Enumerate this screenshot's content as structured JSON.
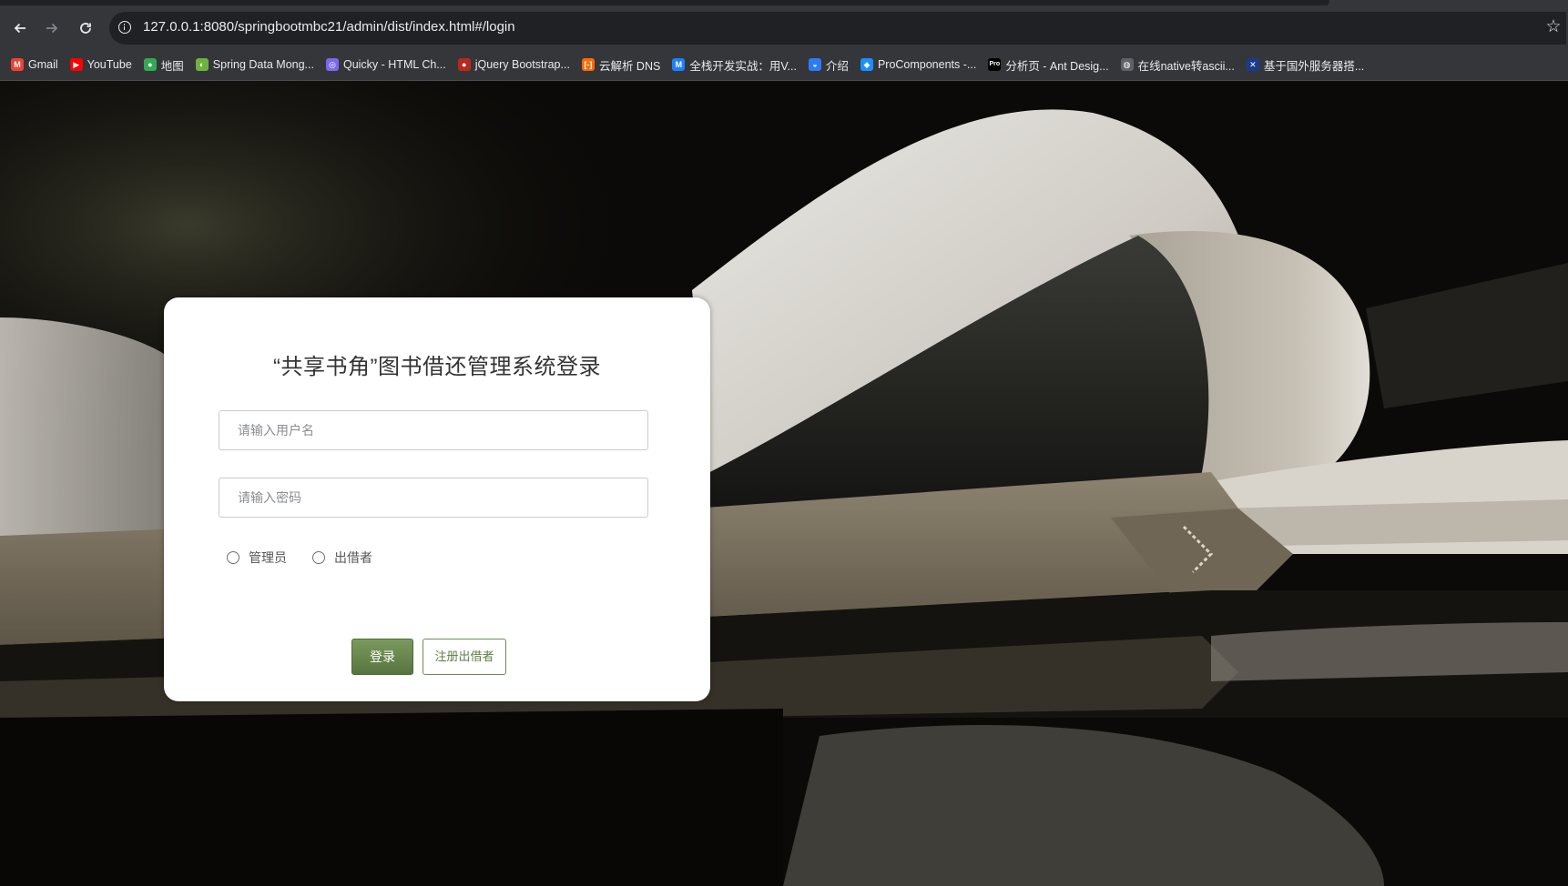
{
  "browser": {
    "url": "127.0.0.1:8080/springbootmbc21/admin/dist/index.html#/login",
    "bookmarks": [
      {
        "label": "Gmail",
        "icon": "gmail-icon",
        "color": "#ea4335",
        "glyph": "M"
      },
      {
        "label": "YouTube",
        "icon": "youtube-icon",
        "color": "#ff0000",
        "glyph": "▶"
      },
      {
        "label": "地图",
        "icon": "maps-icon",
        "color": "#34a853",
        "glyph": "●"
      },
      {
        "label": "Spring Data Mong...",
        "icon": "spring-leaf-icon",
        "color": "#6db33f",
        "glyph": "◐"
      },
      {
        "label": "Quicky - HTML Ch...",
        "icon": "quicky-icon",
        "color": "#7b68ee",
        "glyph": "◎"
      },
      {
        "label": "jQuery Bootstrap...",
        "icon": "jquery-icon",
        "color": "#b7291f",
        "glyph": "●"
      },
      {
        "label": "云解析 DNS",
        "icon": "aliyun-icon",
        "color": "#ff6a00",
        "glyph": "[-]"
      },
      {
        "label": "全栈开发实战：用V...",
        "icon": "m-icon",
        "color": "#1e80ff",
        "glyph": "M"
      },
      {
        "label": "介绍",
        "icon": "intro-icon",
        "color": "#2f7bf5",
        "glyph": "◒"
      },
      {
        "label": "ProComponents -...",
        "icon": "procomponents-icon",
        "color": "#1890ff",
        "glyph": "◆"
      },
      {
        "label": "分析页 - Ant Desig...",
        "icon": "pro-icon",
        "color": "#000000",
        "glyph": "Pro"
      },
      {
        "label": "在线native转ascii...",
        "icon": "globe-icon",
        "color": "#5f6368",
        "glyph": "◍"
      },
      {
        "label": "基于国外服务器搭...",
        "icon": "flag-icon",
        "color": "#1a3b8c",
        "glyph": "✕"
      }
    ]
  },
  "login": {
    "title": "“共享书角”图书借还管理系统登录",
    "username_placeholder": "请输入用户名",
    "password_placeholder": "请输入密码",
    "roles": [
      "管理员",
      "出借者"
    ],
    "login_button": "登录",
    "register_button": "注册出借者",
    "accent_color": "#5f7d45"
  }
}
